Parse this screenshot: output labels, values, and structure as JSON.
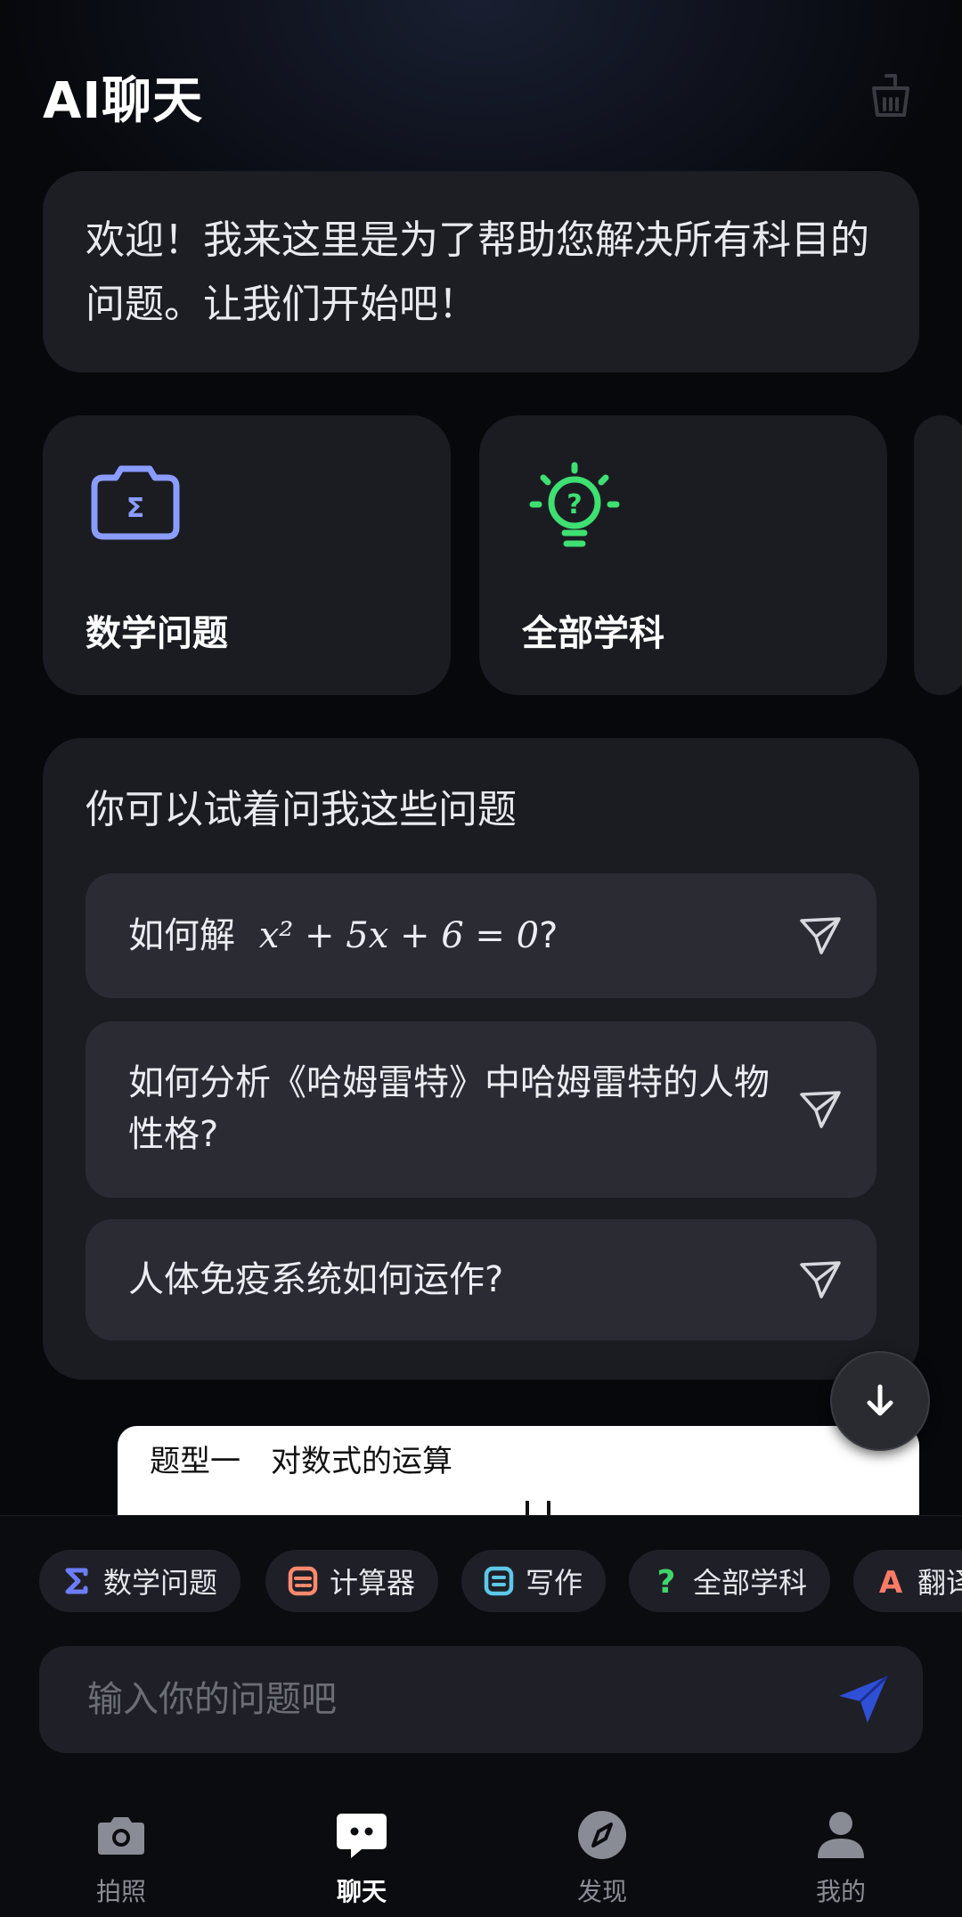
{
  "header": {
    "title": "AI聊天",
    "clear_icon": "broom-clean-icon"
  },
  "welcome": {
    "message": "欢迎！我来这里是为了帮助您解决所有科目的问题。让我们开始吧！"
  },
  "features": [
    {
      "label": "数学问题",
      "icon": "sigma-camera-icon",
      "color": "#8a9cff"
    },
    {
      "label": "全部学科",
      "icon": "lightbulb-question-icon",
      "color": "#3ee072"
    }
  ],
  "suggestions": {
    "title": "你可以试着问我这些问题",
    "items": [
      {
        "text_prefix": "如何解",
        "math": "x² + 5x + 6 = 0",
        "text_suffix": "?"
      },
      {
        "text": "如何分析《哈姆雷特》中哈姆雷特的人物性格?"
      },
      {
        "text": "人体免疫系统如何运作?"
      }
    ]
  },
  "preview": {
    "text": "题型一　对数式的运算"
  },
  "chips": [
    {
      "label": "数学问题",
      "icon": "sigma-icon",
      "color": "#6d7dff"
    },
    {
      "label": "计算器",
      "icon": "calculator-icon",
      "color": "#ff8a6e"
    },
    {
      "label": "写作",
      "icon": "writing-icon",
      "color": "#5cc8ea"
    },
    {
      "label": "全部学科",
      "icon": "question-icon",
      "color": "#3fd56b"
    },
    {
      "label": "翻译",
      "icon": "translate-icon",
      "color": "#ff7b66"
    }
  ],
  "input": {
    "placeholder": "输入你的问题吧"
  },
  "tabs": [
    {
      "label": "拍照",
      "icon": "camera-icon"
    },
    {
      "label": "聊天",
      "icon": "chat-icon",
      "active": true
    },
    {
      "label": "发现",
      "icon": "compass-icon"
    },
    {
      "label": "我的",
      "icon": "person-icon"
    }
  ]
}
